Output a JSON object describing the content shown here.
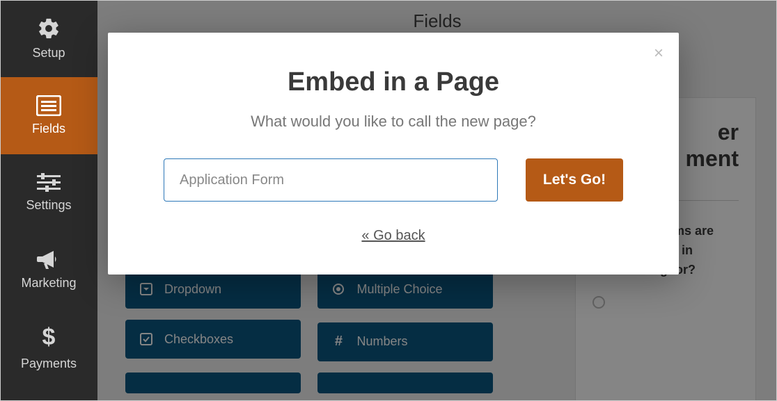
{
  "sidebar": {
    "items": [
      {
        "label": "Setup"
      },
      {
        "label": "Fields"
      },
      {
        "label": "Settings"
      },
      {
        "label": "Marketing"
      },
      {
        "label": "Payments"
      }
    ]
  },
  "mainHeader": "Fields",
  "fieldButtons": {
    "dropdown": "Dropdown",
    "multipleChoice": "Multiple Choice",
    "checkboxes": "Checkboxes",
    "numbers": "Numbers"
  },
  "preview": {
    "title_line2": "er",
    "title_line3": "ment",
    "question": "Which programs are you interested in volunteering for?"
  },
  "modal": {
    "title": "Embed in a Page",
    "subtitle": "What would you like to call the new page?",
    "placeholder": "Application Form",
    "button": "Let's Go!",
    "back": "« Go back"
  }
}
